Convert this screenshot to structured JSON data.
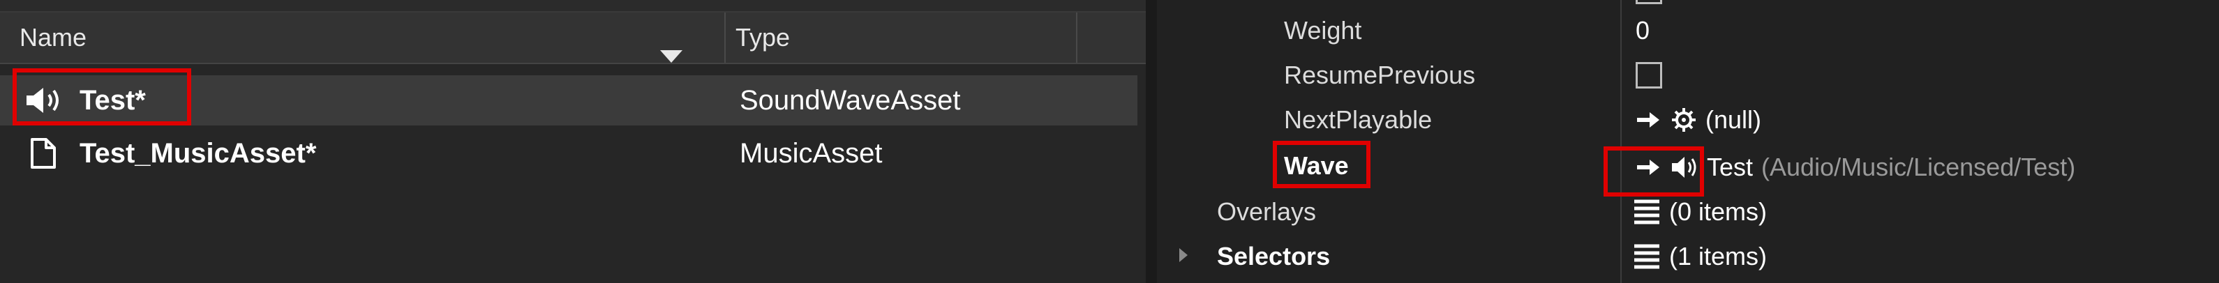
{
  "asset_list": {
    "columns": {
      "name": "Name",
      "type": "Type"
    },
    "rows": [
      {
        "name": "Test*",
        "type": "SoundWaveAsset",
        "icon": "speaker-icon"
      },
      {
        "name": "Test_MusicAsset*",
        "type": "MusicAsset",
        "icon": "document-icon"
      }
    ]
  },
  "properties": {
    "weight": {
      "label": "Weight",
      "value": "0"
    },
    "resume_previous": {
      "label": "ResumePrevious",
      "checked": false
    },
    "next_playable": {
      "label": "NextPlayable",
      "value": "(null)",
      "icons": [
        "arrow-right-icon",
        "gear-icon"
      ]
    },
    "wave": {
      "label": "Wave",
      "value": "Test",
      "path": "(Audio/Music/Licensed/Test)",
      "icons": [
        "arrow-right-icon",
        "speaker-icon"
      ]
    },
    "overlays": {
      "label": "Overlays",
      "value": "(0 items)",
      "icon": "list-icon"
    },
    "selectors": {
      "label": "Selectors",
      "value": "(1 items)",
      "icon": "list-icon"
    }
  },
  "colors": {
    "highlight": "#e00000",
    "selected_row": "#3b3b3b",
    "background": "#262626"
  }
}
